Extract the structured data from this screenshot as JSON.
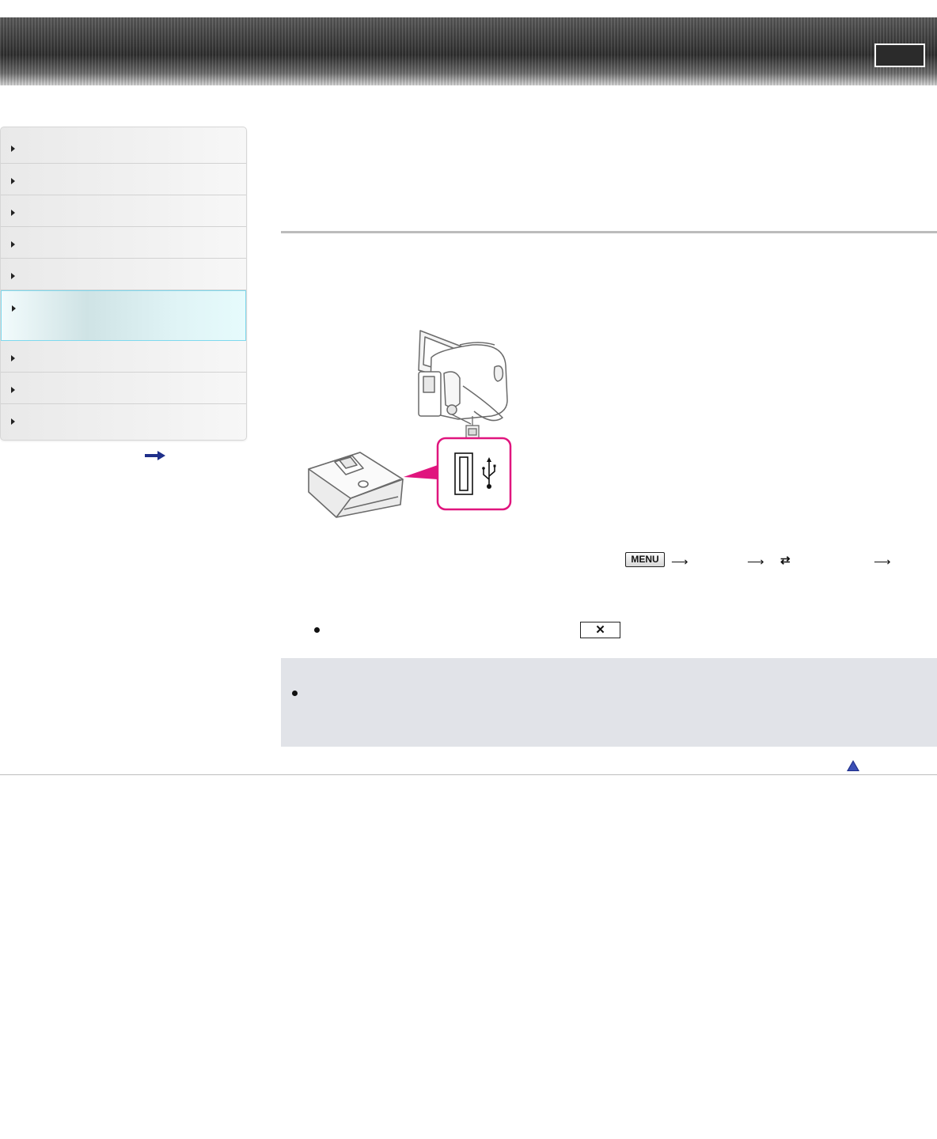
{
  "header": {
    "box_label": ""
  },
  "sidebar": {
    "items": [
      {
        "label": ""
      },
      {
        "label": ""
      },
      {
        "label": ""
      },
      {
        "label": ""
      },
      {
        "label": ""
      },
      {
        "label": "",
        "active": true
      },
      {
        "label": ""
      },
      {
        "label": ""
      },
      {
        "label": ""
      }
    ],
    "more_icon": "right-arrow-icon"
  },
  "main": {
    "title": "",
    "illustration": {
      "icons": [
        "camcorder-icon",
        "usb-cable-icon",
        "usb-symbol-icon",
        "dvd-writer-icon"
      ]
    },
    "menu_path": {
      "menu_label": "MENU",
      "arrow_icon": "right-arrow-icon",
      "swap_icon": "swap-arrows-icon"
    },
    "close_button_icon": "close-x-icon",
    "note_box": {
      "text": ""
    },
    "back_to_top_icon": "up-triangle-icon"
  },
  "colors": {
    "header_dark": "#3a3a3a",
    "active_border": "#7fd9ee",
    "highlight_magenta": "#e0157e",
    "note_bg": "#e1e3e8",
    "link_blue": "#1f2f8a"
  }
}
